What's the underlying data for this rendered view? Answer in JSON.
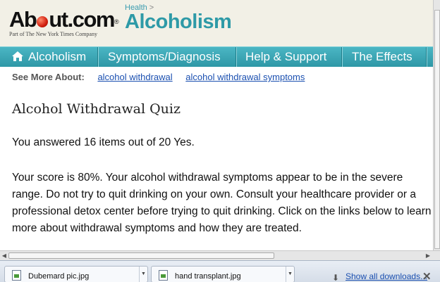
{
  "header": {
    "logo_text_a": "Ab",
    "logo_text_b": "ut.com",
    "tagline": "Part of The New York Times Company",
    "breadcrumb": "Health",
    "breadcrumb_arrow": ">",
    "site_title": "Alcoholism"
  },
  "nav": {
    "items": [
      {
        "label": "Alcoholism",
        "icon": "home-icon"
      },
      {
        "label": "Symptoms/Diagnosis"
      },
      {
        "label": "Help & Support"
      },
      {
        "label": "The Effects"
      }
    ]
  },
  "see_more": {
    "label": "See More About:",
    "links": [
      "alcohol withdrawal",
      "alcohol withdrawal symptoms"
    ]
  },
  "article": {
    "title": "Alcohol Withdrawal Quiz",
    "result": "You answered 16 items out of 20 Yes.",
    "body": "Your score is 80%. Your alcohol withdrawal symptoms appear to be in the severe range. Do not try to quit drinking on your own. Consult your healthcare provider or a professional detox center before trying to quit drinking. Click on the links below to learn more about withdrawal symptoms and how they are treated."
  },
  "downloads": {
    "items": [
      "Dubemard pic.jpg",
      "hand transplant.jpg"
    ],
    "show_all": "Show all downloads..."
  },
  "colors": {
    "accent": "#2e9aa7",
    "link": "#1a4fb0"
  }
}
